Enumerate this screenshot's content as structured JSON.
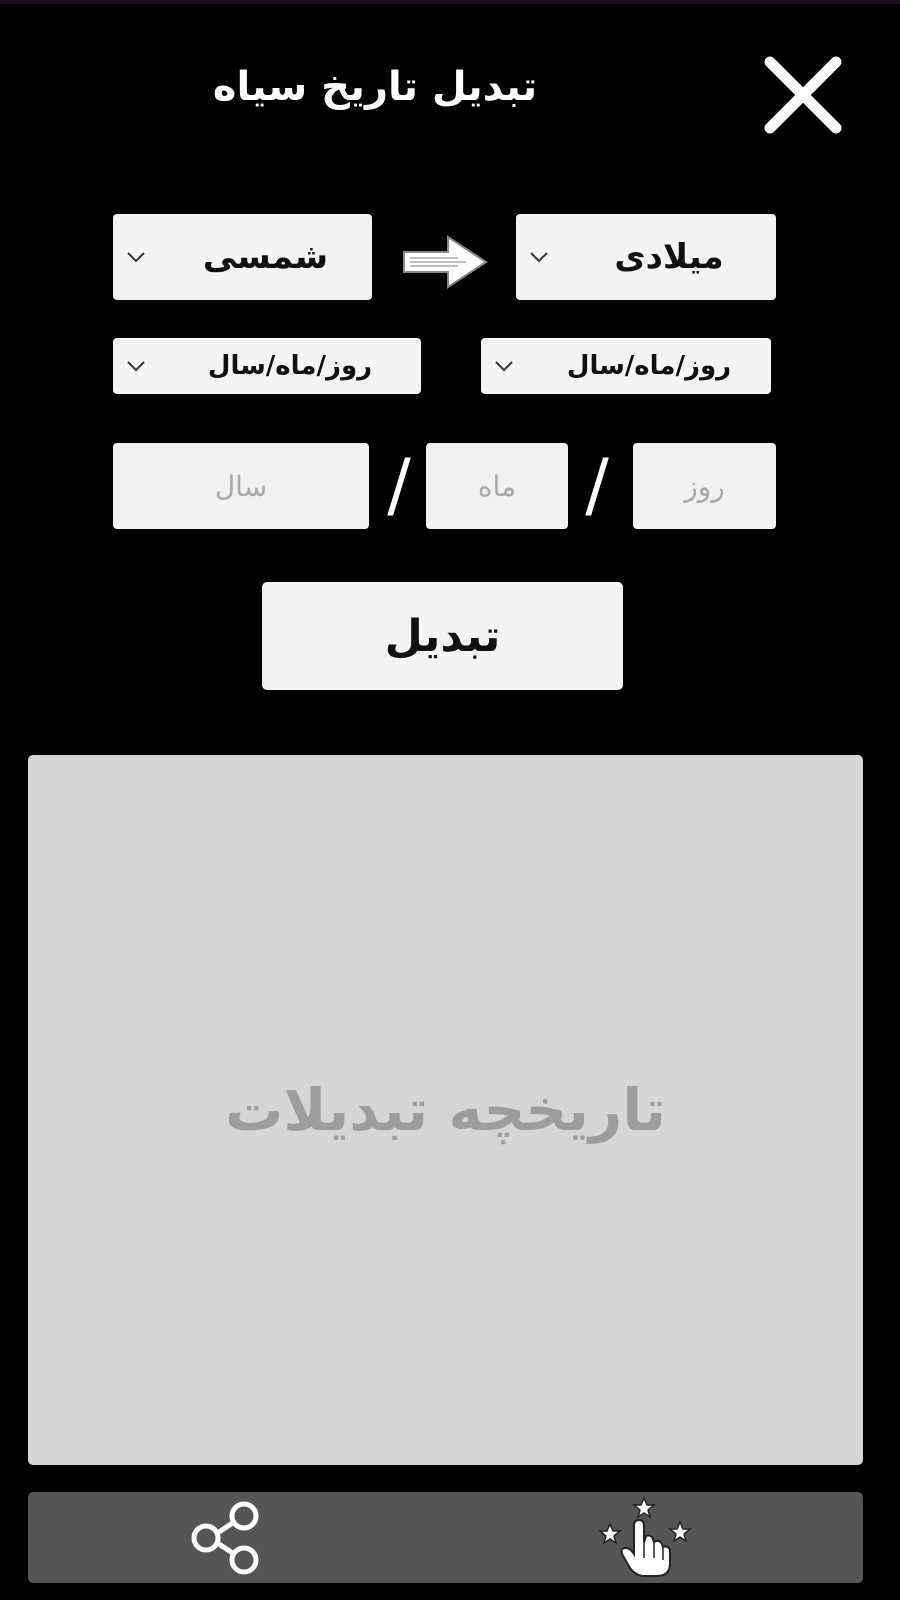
{
  "app": {
    "title": "تبدیل تاریخ سیاه"
  },
  "converter": {
    "target_calendar": "شمسی",
    "source_calendar": "میلادی",
    "target_format": "روز/ماه/سال",
    "source_format": "روز/ماه/سال",
    "year_placeholder": "سال",
    "month_placeholder": "ماه",
    "day_placeholder": "روز",
    "separator": "/",
    "convert_label": "تبدیل"
  },
  "history": {
    "placeholder": "تاریخچه تبدیلات"
  },
  "icons": {
    "close": "close-icon",
    "arrow": "arrow-right-icon",
    "chevron": "chevron-down-icon",
    "share": "share-icon",
    "rate": "hand-stars-icon"
  },
  "colors": {
    "background": "#000000",
    "field": "#f4f4f4",
    "history_panel": "#d6d6d6",
    "bottom_bar": "#555555",
    "placeholder_text": "#9d9d9d"
  }
}
